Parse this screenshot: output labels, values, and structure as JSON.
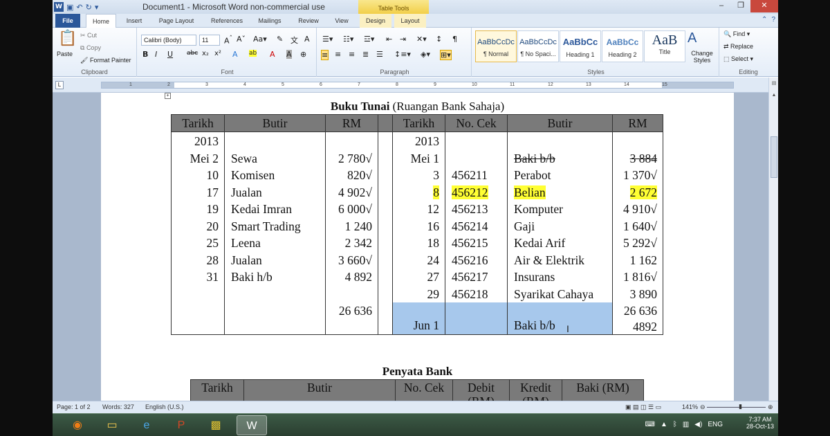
{
  "window": {
    "title": "Document1 - Microsoft Word non-commercial use",
    "contextual_tab_group": "Table Tools",
    "controls": {
      "minimize": "‒",
      "maximize": "❐",
      "close": "✕"
    }
  },
  "quick_access": {
    "app_icon": "W",
    "save_icon": "save-icon",
    "undo_icon": "undo-icon",
    "redo_icon": "redo-icon"
  },
  "tabs": [
    "File",
    "Home",
    "Insert",
    "Page Layout",
    "References",
    "Mailings",
    "Review",
    "View",
    "Design",
    "Layout"
  ],
  "ribbon": {
    "clipboard": {
      "label": "Clipboard",
      "paste": "Paste",
      "cut": "Cut",
      "copy": "Copy",
      "format_painter": "Format Painter"
    },
    "font": {
      "label": "Font",
      "font_name": "Calibri (Body)",
      "font_size": "11"
    },
    "paragraph": {
      "label": "Paragraph"
    },
    "styles": {
      "label": "Styles",
      "items": [
        {
          "sample": "AaBbCcDc",
          "name": "¶ Normal"
        },
        {
          "sample": "AaBbCcDc",
          "name": "¶ No Spaci..."
        },
        {
          "sample": "AaBbCc",
          "name": "Heading 1"
        },
        {
          "sample": "AaBbCc",
          "name": "Heading 2"
        },
        {
          "sample": "AaB",
          "name": "Title"
        }
      ],
      "change_styles": "Change Styles"
    },
    "editing": {
      "label": "Editing",
      "find": "Find",
      "replace": "Replace",
      "select": "Select"
    }
  },
  "ruler_ticks": [
    "1",
    "2",
    "3",
    "4",
    "5",
    "6",
    "7",
    "8",
    "9",
    "10",
    "11",
    "12",
    "13",
    "14",
    "15"
  ],
  "document": {
    "cash_book": {
      "title_bold": "Buku Tunai",
      "title_rest": "(Ruangan Bank Sahaja)",
      "headers": [
        "Tarikh",
        "Butir",
        "RM",
        "",
        "Tarikh",
        "No. Cek",
        "Butir",
        "RM"
      ],
      "debit_rows": [
        {
          "date": "2013",
          "item": "",
          "amount": ""
        },
        {
          "date": "Mei 2",
          "item": "Sewa",
          "amount": "2 780√"
        },
        {
          "date": "10",
          "item": "Komisen",
          "amount": "820√"
        },
        {
          "date": "17",
          "item": "Jualan",
          "amount": "4 902√"
        },
        {
          "date": "19",
          "item": "Kedai Imran",
          "amount": "6 000√"
        },
        {
          "date": "20",
          "item": "Smart Trading",
          "amount": "1 240"
        },
        {
          "date": "25",
          "item": "Leena",
          "amount": "2 342"
        },
        {
          "date": "28",
          "item": "Jualan",
          "amount": "3 660√"
        },
        {
          "date": "31",
          "item": "Baki h/b",
          "amount": "4 892"
        }
      ],
      "credit_rows": [
        {
          "date": "2013",
          "cheque": "",
          "item": "",
          "amount": ""
        },
        {
          "date": "Mei 1",
          "cheque": "",
          "item": "Baki b/b",
          "amount": "3 884"
        },
        {
          "date": "3",
          "cheque": "456211",
          "item": "Perabot",
          "amount": "1 370√"
        },
        {
          "date": "8",
          "cheque": "456212",
          "item": "Belian",
          "amount": "2 672"
        },
        {
          "date": "12",
          "cheque": "456213",
          "item": "Komputer",
          "amount": "4 910√"
        },
        {
          "date": "16",
          "cheque": "456214",
          "item": "Gaji",
          "amount": "1 640√"
        },
        {
          "date": "18",
          "cheque": "456215",
          "item": "Kedai Arif",
          "amount": "5 292√"
        },
        {
          "date": "24",
          "cheque": "456216",
          "item": "Air & Elektrik",
          "amount": "1 162"
        },
        {
          "date": "27",
          "cheque": "456217",
          "item": "Insurans",
          "amount": "1 816√"
        },
        {
          "date": "29",
          "cheque": "456218",
          "item": "Syarikat Cahaya",
          "amount": "3 890"
        }
      ],
      "debit_total": "26 636",
      "credit_total": "26 636",
      "closing": {
        "date": "Jun 1",
        "item": "Baki b/b",
        "amount": "4892"
      }
    },
    "bank_statement": {
      "title": "Penyata Bank",
      "headers": [
        "Tarikh",
        "Butir",
        "No. Cek",
        "Debit (RM)",
        "Kredit (RM)",
        "Baki (RM)"
      ]
    }
  },
  "status": {
    "page": "Page: 1 of 2",
    "words": "Words: 327",
    "language": "English (U.S.)",
    "zoom": "141%"
  },
  "taskbar": {
    "time": "7:37 AM",
    "date": "28-Oct-13",
    "lang": "ENG"
  }
}
